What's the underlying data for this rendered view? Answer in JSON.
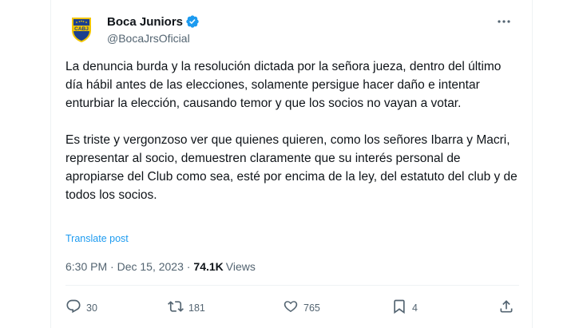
{
  "account": {
    "display_name": "Boca Juniors",
    "handle": "@BocaJrsOficial",
    "avatar_icon": "boca-juniors-crest-icon",
    "verified_icon": "verified-badge-icon",
    "badge_color": "#1d9bf0"
  },
  "tweet": {
    "paragraphs": [
      "La denuncia burda y la resolución dictada por la señora jueza, dentro del último día hábil antes de las elecciones, solamente persigue hacer daño e intentar enturbiar la elección, causando temor y que los socios no vayan a votar.",
      "Es triste y vergonzoso ver que quienes quieren, como los señores Ibarra y Macri, representar al socio, demuestren claramente que su interés personal de apropiarse del Club como sea, esté por encima de la ley, del estatuto del club y de todos los socios."
    ],
    "translate_label": "Translate post",
    "time_date": "6:30 PM · Dec 15, 2023 · ",
    "views_count": "74.1K",
    "views_label": "Views"
  },
  "actions": {
    "replies": "30",
    "reposts": "181",
    "likes": "765",
    "bookmarks": "4"
  },
  "colors": {
    "text": "#0f1419",
    "secondary": "#536471",
    "link": "#1d9bf0",
    "crest_blue": "#1b3f8f",
    "crest_gold": "#f2c500"
  }
}
